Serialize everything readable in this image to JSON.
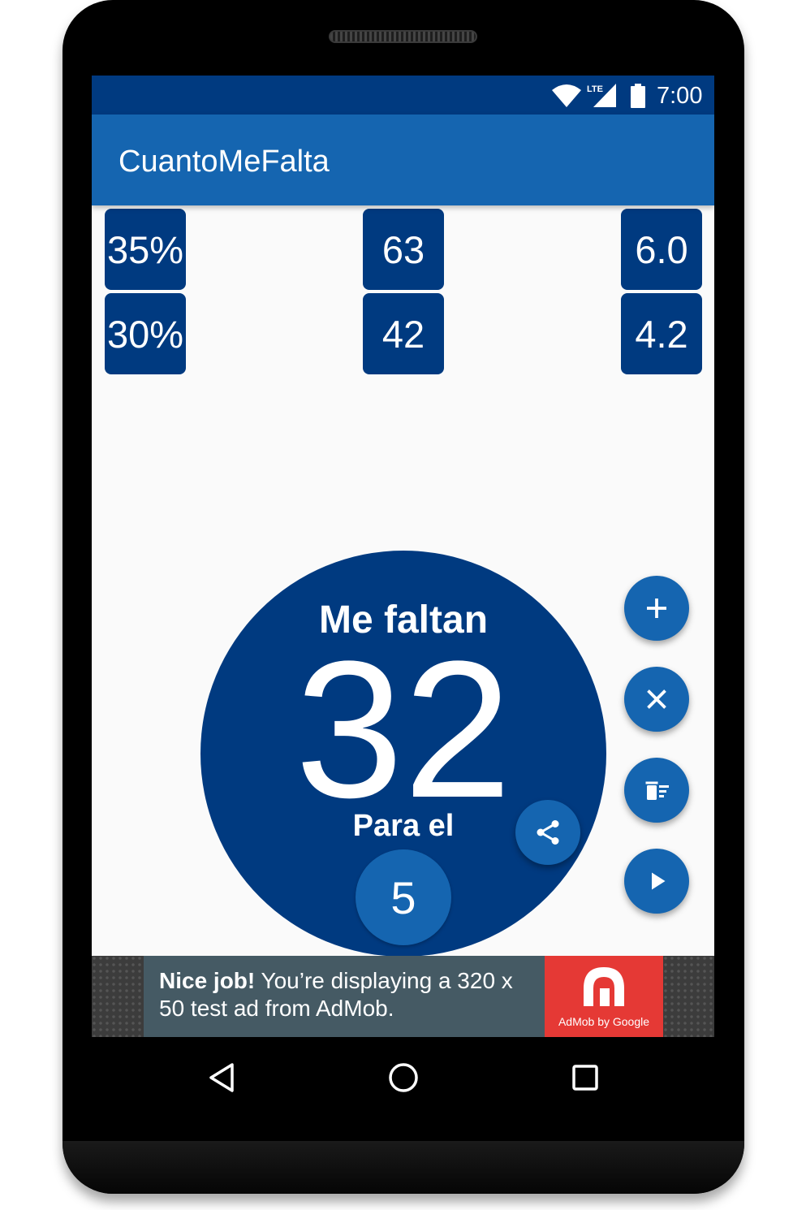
{
  "status_bar": {
    "time": "7:00",
    "network_label": "LTE",
    "icons": [
      "wifi-icon",
      "lte-signal-icon",
      "battery-icon"
    ]
  },
  "app_bar": {
    "title": "CuantoMeFalta"
  },
  "stats": {
    "row1": {
      "percent": "35%",
      "count": "63",
      "grade": "6.0"
    },
    "row2": {
      "percent": "30%",
      "count": "42",
      "grade": "4.2"
    }
  },
  "result": {
    "heading": "Me faltan",
    "value": "32",
    "subheading": "Para el",
    "target": "5"
  },
  "fabs": [
    "plus-icon",
    "close-icon",
    "clear-all-icon",
    "play-icon",
    "share-icon"
  ],
  "ad": {
    "bold": "Nice job!",
    "text": " You’re displaying a 320 x 50 test ad from AdMob.",
    "logo_caption": "AdMob by Google"
  },
  "nav": [
    "back-icon",
    "home-icon",
    "recents-icon"
  ],
  "colors": {
    "primary_dark": "#003a80",
    "primary": "#1565b0",
    "background": "#fafafa",
    "ad_panel": "#455a64",
    "ad_logo": "#e53935"
  }
}
